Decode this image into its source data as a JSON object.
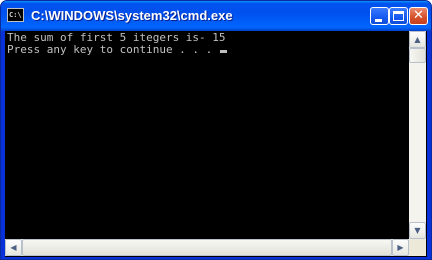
{
  "window": {
    "title": "C:\\WINDOWS\\system32\\cmd.exe",
    "icon_text": "C:\\"
  },
  "titlebar_buttons": {
    "minimize": "minimize-icon",
    "maximize": "maximize-icon",
    "close": "close-icon"
  },
  "console": {
    "lines": [
      "The sum of first 5 itegers is- 15",
      "Press any key to continue . . . "
    ],
    "text_color": "#c0c0c0",
    "background": "#000000"
  },
  "scrollbars": {
    "up_arrow": "▲",
    "down_arrow": "▼",
    "left_arrow": "◀",
    "right_arrow": "▶"
  }
}
